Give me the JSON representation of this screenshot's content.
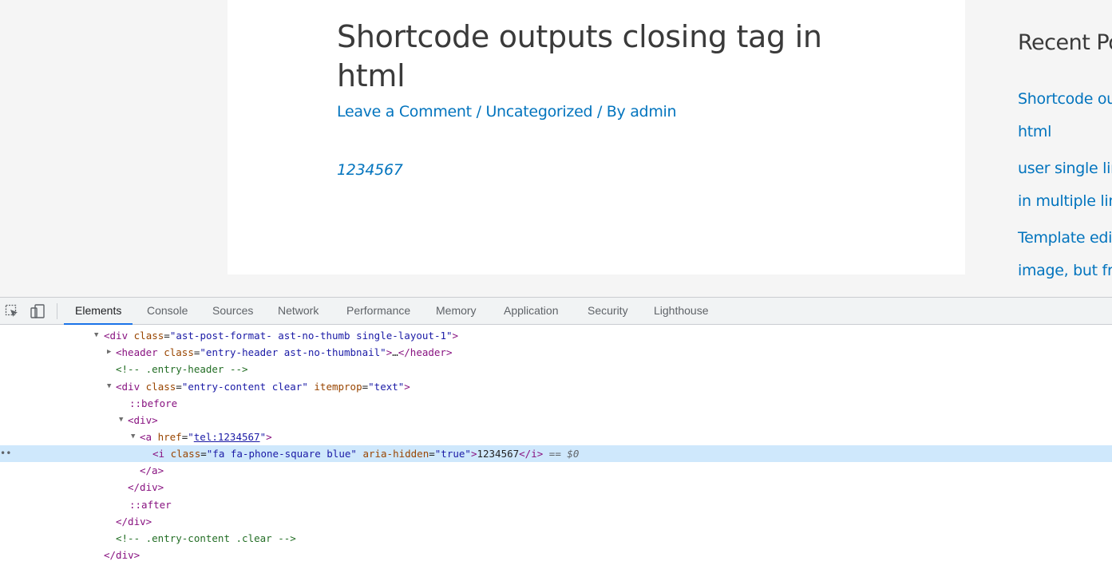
{
  "website": {
    "post_title": "Shortcode outputs closing tag in html",
    "meta": {
      "comment_link": "Leave a Comment",
      "sep1": " / ",
      "category_link": "Uncategorized",
      "sep2": " / By ",
      "author_link": "admin"
    },
    "phone_link": "1234567",
    "sidebar": {
      "title": "Recent Po",
      "links": [
        "Shortcode ou",
        "html",
        "user single lin",
        "in multiple lin",
        "Template edit",
        "image, but fr"
      ]
    }
  },
  "devtools": {
    "tabs": [
      "Elements",
      "Console",
      "Sources",
      "Network",
      "Performance",
      "Memory",
      "Application",
      "Security",
      "Lighthouse"
    ],
    "active_tab": "Elements",
    "dom": {
      "l1": {
        "open": "<div",
        "a1": "class",
        "eq": "=",
        "v1": "\"ast-post-format- ast-no-thumb single-layout-1\"",
        "close": ">"
      },
      "l2": {
        "open": "<header",
        "a1": "class",
        "eq": "=",
        "v1": "\"entry-header ast-no-thumbnail\"",
        "close": ">",
        "ellipsis": "…",
        "end": "</header>"
      },
      "l3": {
        "comment": "<!-- .entry-header -->"
      },
      "l4": {
        "open": "<div",
        "a1": "class",
        "eq1": "=",
        "v1": "\"entry-content clear\"",
        "a2": "itemprop",
        "eq2": "=",
        "v2": "\"text\"",
        "close": ">"
      },
      "l5": {
        "pseudo": "::before"
      },
      "l6": {
        "open": "<div>"
      },
      "l7": {
        "open": "<a",
        "a1": "href",
        "eq": "=",
        "q1": "\"",
        "v1": "tel:1234567",
        "q2": "\"",
        "close": ">"
      },
      "l8": {
        "open": "<i",
        "a1": "class",
        "eq1": "=",
        "v1": "\"fa fa-phone-square blue\"",
        "a2": "aria-hidden",
        "eq2": "=",
        "v2": "\"true\"",
        "close": ">",
        "text": "1234567",
        "end": "</i>",
        "marker": " == $0",
        "dots": "••"
      },
      "l9": {
        "close": "</a>"
      },
      "l10": {
        "close": "</div>"
      },
      "l11": {
        "pseudo": "::after"
      },
      "l12": {
        "close": "</div>"
      },
      "l13": {
        "comment": "<!-- .entry-content .clear -->"
      },
      "l14": {
        "close": "</div>"
      }
    }
  },
  "colors": {
    "link": "#0274be",
    "heading": "#3a3a3a",
    "selection": "#cfe8fc",
    "active_tab_underline": "#1a73e8"
  }
}
